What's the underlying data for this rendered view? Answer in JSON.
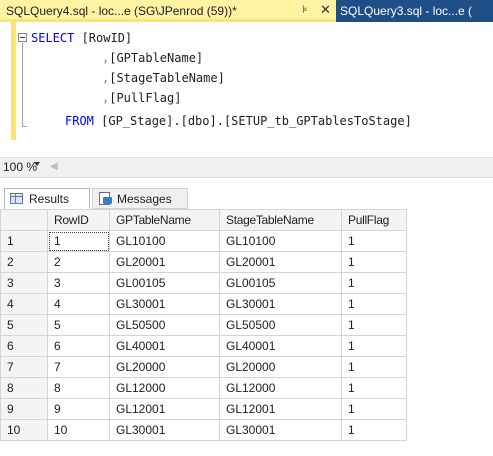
{
  "tabs": [
    {
      "title": "SQLQuery4.sql - loc...e (SG\\JPenrod (59))*",
      "pin": "⊧",
      "close": "✕"
    },
    {
      "title": "SQLQuery3.sql - loc...e ("
    }
  ],
  "editor": {
    "lines": [
      {
        "kw": "SELECT",
        "text": " [RowID]"
      },
      {
        "punc": ",",
        "text": "[GPTableName]"
      },
      {
        "punc": ",",
        "text": "[StageTableName]"
      },
      {
        "punc": ",",
        "text": "[PullFlag]"
      },
      {
        "kw": "FROM",
        "text": " [GP_Stage].[dbo].[SETUP_tb_GPTablesToStage]"
      }
    ]
  },
  "zoom": {
    "value": "100 %"
  },
  "result_tabs": {
    "results": "Results",
    "messages": "Messages"
  },
  "grid": {
    "columns": [
      "",
      "RowID",
      "GPTableName",
      "StageTableName",
      "PullFlag"
    ],
    "rows": [
      [
        "1",
        "1",
        "GL10100",
        "GL10100",
        "1"
      ],
      [
        "2",
        "2",
        "GL20001",
        "GL20001",
        "1"
      ],
      [
        "3",
        "3",
        "GL00105",
        "GL00105",
        "1"
      ],
      [
        "4",
        "4",
        "GL30001",
        "GL30001",
        "1"
      ],
      [
        "5",
        "5",
        "GL50500",
        "GL50500",
        "1"
      ],
      [
        "6",
        "6",
        "GL40001",
        "GL40001",
        "1"
      ],
      [
        "7",
        "7",
        "GL20000",
        "GL20000",
        "1"
      ],
      [
        "8",
        "8",
        "GL12000",
        "GL12000",
        "1"
      ],
      [
        "9",
        "9",
        "GL12001",
        "GL12001",
        "1"
      ],
      [
        "10",
        "10",
        "GL30001",
        "GL30001",
        "1"
      ]
    ]
  }
}
